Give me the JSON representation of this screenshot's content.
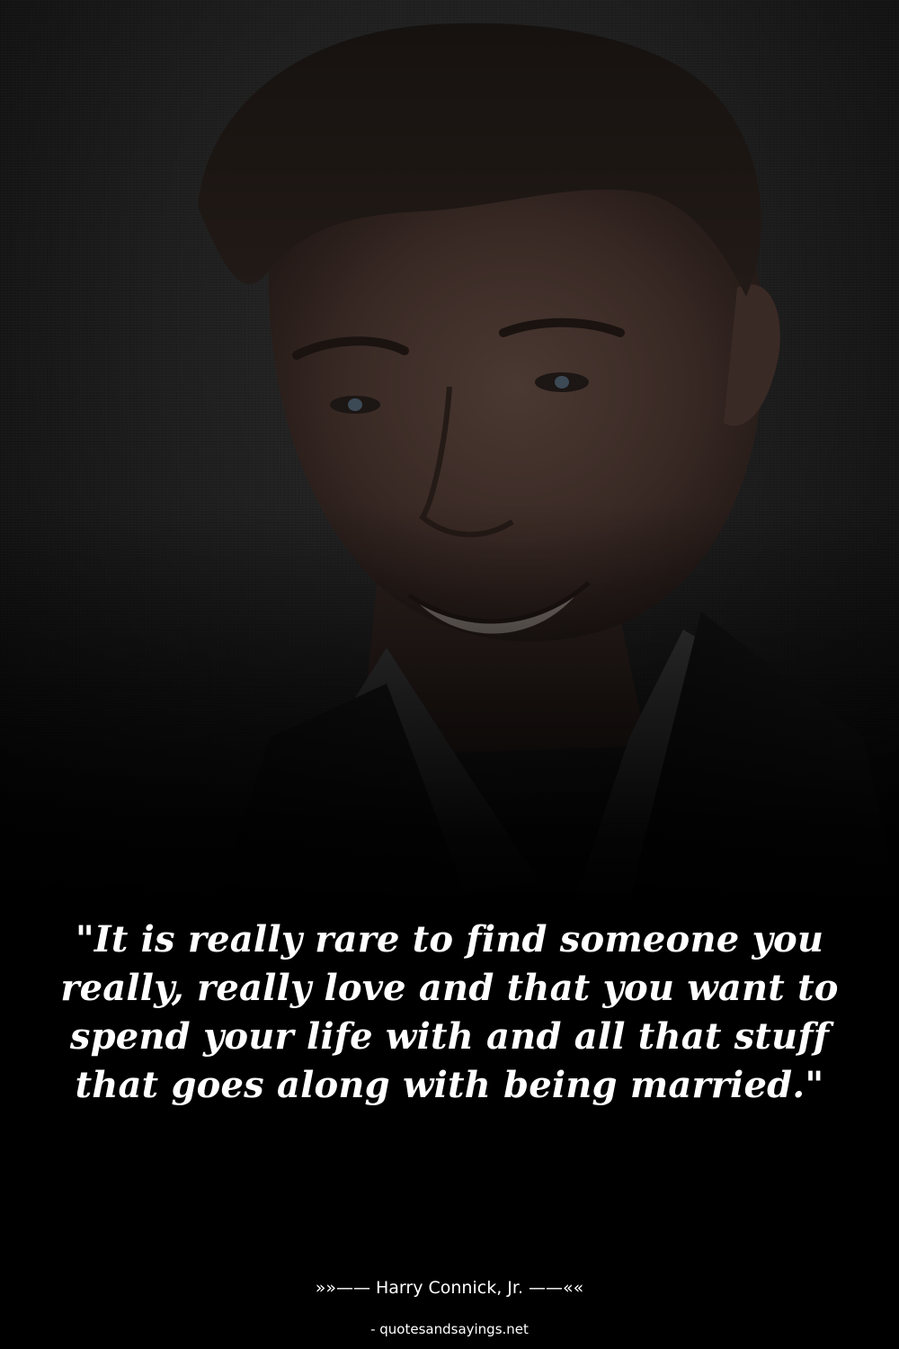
{
  "quote": {
    "text": "\"It is really rare to find someone you really, really love and that you want to spend your life with and all that stuff that goes along with being married.\"",
    "author_line": "»»—— Harry Connick, Jr. ——««"
  },
  "footer": {
    "source": "- quotesandsayings.net"
  },
  "colors": {
    "background": "#000000",
    "text": "#ffffff"
  }
}
